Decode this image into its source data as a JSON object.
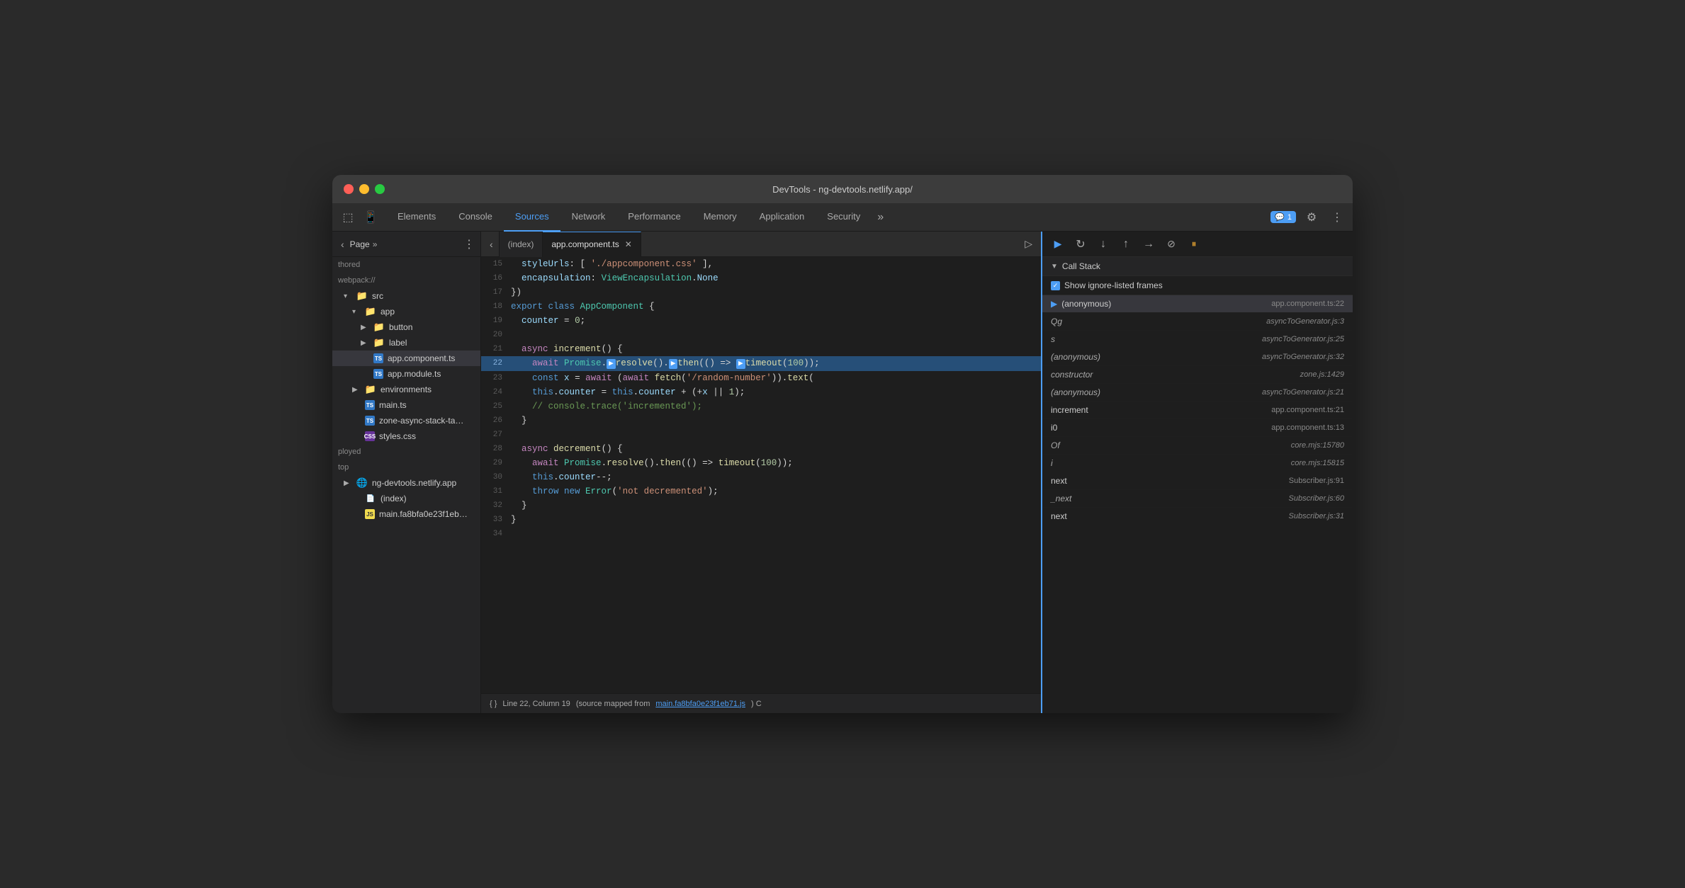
{
  "window": {
    "title": "DevTools - ng-devtools.netlify.app/"
  },
  "titlebar": {
    "title": "DevTools - ng-devtools.netlify.app/"
  },
  "tabbar": {
    "tabs": [
      {
        "id": "elements",
        "label": "Elements",
        "active": false
      },
      {
        "id": "console",
        "label": "Console",
        "active": false
      },
      {
        "id": "sources",
        "label": "Sources",
        "active": true
      },
      {
        "id": "network",
        "label": "Network",
        "active": false
      },
      {
        "id": "performance",
        "label": "Performance",
        "active": false
      },
      {
        "id": "memory",
        "label": "Memory",
        "active": false
      },
      {
        "id": "application",
        "label": "Application",
        "active": false
      },
      {
        "id": "security",
        "label": "Security",
        "active": false
      }
    ],
    "more_label": "»",
    "notification_icon": "💬",
    "notification_count": "1",
    "settings_icon": "⚙",
    "more_icon": "⋮"
  },
  "sidebar": {
    "header": {
      "label": "Page",
      "more_label": "»",
      "menu_icon": "⋮"
    },
    "items": [
      {
        "indent": 0,
        "label": "thored",
        "type": "text"
      },
      {
        "indent": 0,
        "label": "webpack://",
        "type": "text"
      },
      {
        "indent": 1,
        "label": "src",
        "type": "folder-orange",
        "expanded": true
      },
      {
        "indent": 2,
        "label": "app",
        "type": "folder-orange",
        "expanded": true
      },
      {
        "indent": 3,
        "label": "button",
        "type": "folder-orange",
        "expanded": false,
        "has_arrow": true
      },
      {
        "indent": 3,
        "label": "label",
        "type": "folder-orange",
        "expanded": false,
        "has_arrow": true
      },
      {
        "indent": 3,
        "label": "app.component.ts",
        "type": "ts",
        "selected": true
      },
      {
        "indent": 3,
        "label": "app.module.ts",
        "type": "ts"
      },
      {
        "indent": 2,
        "label": "environments",
        "type": "folder-orange",
        "expanded": false
      },
      {
        "indent": 2,
        "label": "main.ts",
        "type": "ts"
      },
      {
        "indent": 2,
        "label": "zone-async-stack-ta…",
        "type": "ts"
      },
      {
        "indent": 2,
        "label": "styles.css",
        "type": "css"
      },
      {
        "indent": 0,
        "label": "ployed",
        "type": "text"
      },
      {
        "indent": 0,
        "label": "top",
        "type": "text"
      },
      {
        "indent": 0,
        "label": "ng-devtools.netlify.app",
        "type": "folder-blue"
      },
      {
        "indent": 1,
        "label": "(index)",
        "type": "html"
      },
      {
        "indent": 1,
        "label": "main.fa8bfa0e23f1eb…",
        "type": "js"
      }
    ]
  },
  "code_panel": {
    "tabs": [
      {
        "id": "index",
        "label": "(index)",
        "active": false
      },
      {
        "id": "app_component",
        "label": "app.component.ts",
        "active": true,
        "closeable": true
      }
    ],
    "lines": [
      {
        "num": 15,
        "content": "  styleUrls: ['./appcomponent.css' ],"
      },
      {
        "num": 16,
        "content": "  encapsulation: ViewEncapsulation.None"
      },
      {
        "num": 17,
        "content": "})"
      },
      {
        "num": 18,
        "content": "export class AppComponent {"
      },
      {
        "num": 19,
        "content": "  counter = 0;"
      },
      {
        "num": 20,
        "content": ""
      },
      {
        "num": 21,
        "content": "  async increment() {"
      },
      {
        "num": 22,
        "content": "    await Promise.resolve().then(() => timeout(100));",
        "highlighted": true
      },
      {
        "num": 23,
        "content": "    const x = await (await fetch('/random-number')).text("
      },
      {
        "num": 24,
        "content": "    this.counter = this.counter + (+x || 1);"
      },
      {
        "num": 25,
        "content": "    // console.trace('incremented');"
      },
      {
        "num": 26,
        "content": "  }"
      },
      {
        "num": 27,
        "content": ""
      },
      {
        "num": 28,
        "content": "  async decrement() {"
      },
      {
        "num": 29,
        "content": "    await Promise.resolve().then(() => timeout(100));"
      },
      {
        "num": 30,
        "content": "    this.counter--;"
      },
      {
        "num": 31,
        "content": "    throw new Error('not decremented');"
      },
      {
        "num": 32,
        "content": "  }"
      },
      {
        "num": 33,
        "content": "}"
      },
      {
        "num": 34,
        "content": ""
      }
    ],
    "status": {
      "line_col": "Line 22, Column 19",
      "source_map_text": "(source mapped from main.fa8bfa0e23f1eb71.js)",
      "source_map_link": "main.fa8bfa0e23f1eb71.js"
    }
  },
  "call_stack": {
    "header": "Call Stack",
    "show_ignore": "Show ignore-listed frames",
    "entries": [
      {
        "name": "(anonymous)",
        "location": "app.component.ts:22",
        "current": true,
        "italic_name": false,
        "italic_loc": false
      },
      {
        "name": "Qg",
        "location": "asyncToGenerator.js:3",
        "current": false,
        "italic_name": true,
        "italic_loc": true
      },
      {
        "name": "s",
        "location": "asyncToGenerator.js:25",
        "current": false,
        "italic_name": true,
        "italic_loc": true
      },
      {
        "name": "(anonymous)",
        "location": "asyncToGenerator.js:32",
        "current": false,
        "italic_name": true,
        "italic_loc": true
      },
      {
        "name": "constructor",
        "location": "zone.js:1429",
        "current": false,
        "italic_name": true,
        "italic_loc": true
      },
      {
        "name": "(anonymous)",
        "location": "asyncToGenerator.js:21",
        "current": false,
        "italic_name": true,
        "italic_loc": true
      },
      {
        "name": "increment",
        "location": "app.component.ts:21",
        "current": false,
        "italic_name": false,
        "italic_loc": false
      },
      {
        "name": "i0",
        "location": "app.component.ts:13",
        "current": false,
        "italic_name": false,
        "italic_loc": false
      },
      {
        "name": "Of",
        "location": "core.mjs:15780",
        "current": false,
        "italic_name": true,
        "italic_loc": true
      },
      {
        "name": "i",
        "location": "core.mjs:15815",
        "current": false,
        "italic_name": true,
        "italic_loc": true
      },
      {
        "name": "next",
        "location": "Subscriber.js:91",
        "current": false,
        "italic_name": false,
        "italic_loc": false
      },
      {
        "name": "_next",
        "location": "Subscriber.js:60",
        "current": false,
        "italic_name": true,
        "italic_loc": true
      },
      {
        "name": "next",
        "location": "Subscriber.js:31",
        "current": false,
        "italic_name": false,
        "italic_loc": true
      }
    ],
    "toolbar": {
      "resume": "▶",
      "step_over": "↺",
      "step_into": "↓",
      "step_out": "↑",
      "step": "→",
      "deactivate": "⊘",
      "pause_exceptions": "⏸"
    }
  }
}
